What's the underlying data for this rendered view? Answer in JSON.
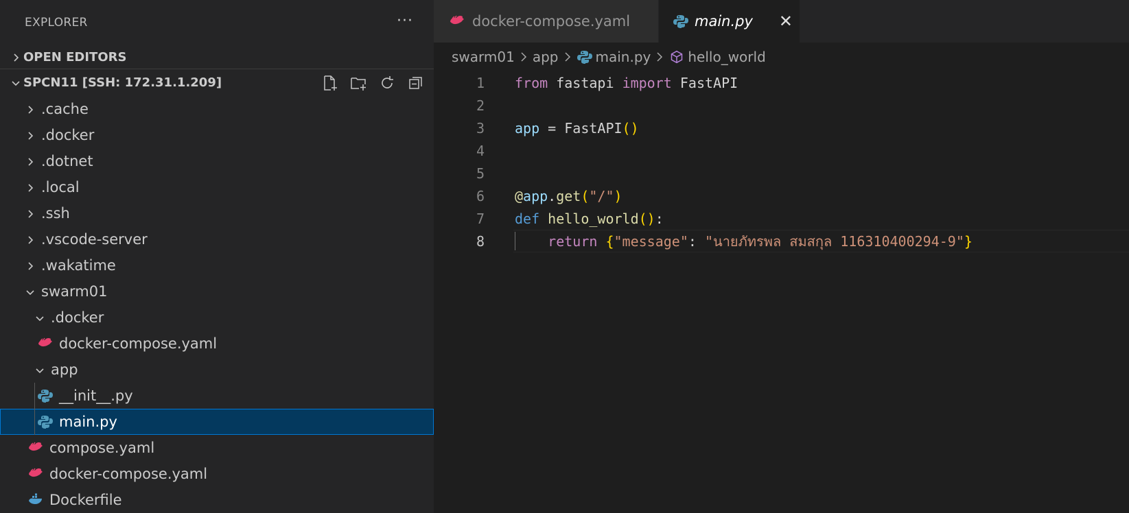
{
  "sidebar": {
    "title": "EXPLORER",
    "more_label": "···",
    "open_editors": "OPEN EDITORS",
    "workspace": "SPCN11 [SSH: 172.31.1.209]",
    "items": [
      {
        "label": ".cache"
      },
      {
        "label": ".docker"
      },
      {
        "label": ".dotnet"
      },
      {
        "label": ".local"
      },
      {
        "label": ".ssh"
      },
      {
        "label": ".vscode-server"
      },
      {
        "label": ".wakatime"
      },
      {
        "label": "swarm01"
      },
      {
        "label": ".docker"
      },
      {
        "label": "docker-compose.yaml"
      },
      {
        "label": "app"
      },
      {
        "label": "__init__.py"
      },
      {
        "label": "main.py"
      },
      {
        "label": "compose.yaml"
      },
      {
        "label": "docker-compose.yaml"
      },
      {
        "label": "Dockerfile"
      }
    ]
  },
  "tabs": [
    {
      "label": "docker-compose.yaml"
    },
    {
      "label": "main.py",
      "close": "✕"
    }
  ],
  "breadcrumb": [
    "swarm01",
    "app",
    "main.py",
    "hello_world"
  ],
  "code": {
    "line_numbers": [
      "1",
      "2",
      "3",
      "4",
      "5",
      "6",
      "7",
      "8"
    ],
    "l1": {
      "from": "from",
      "mod": "fastapi",
      "imp": "import",
      "cls": "FastAPI"
    },
    "l3": {
      "var": "app",
      "eq": " = ",
      "cls": "FastAPI",
      "paren": "()"
    },
    "l6": {
      "at": "@",
      "obj": "app",
      "dot": ".",
      "fn": "get",
      "po": "(",
      "s": "\"/\"",
      "pc": ")"
    },
    "l7": {
      "def": "def",
      "name": "hello_world",
      "paren": "()",
      "colon": ":"
    },
    "l8": {
      "ret": "return",
      "bo": "{",
      "key": "\"message\"",
      "colon": ": ",
      "val": "\"นายภัทรพล สมสกุล 116310400294-9\"",
      "bc": "}"
    }
  }
}
